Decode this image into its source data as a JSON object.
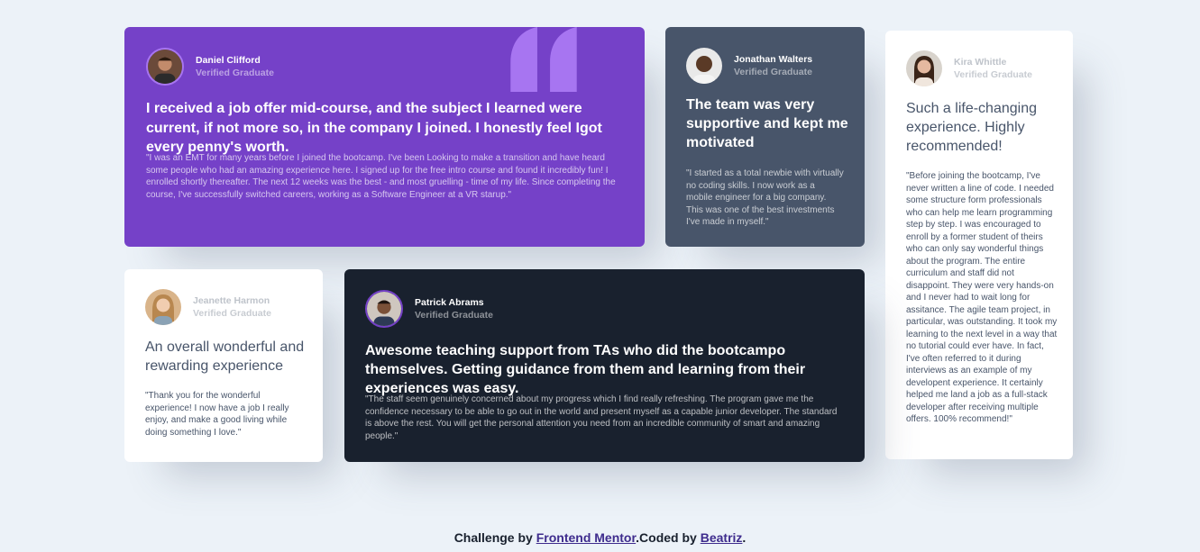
{
  "testimonials": {
    "daniel": {
      "name": "Daniel Clifford",
      "role": "Verified Graduate",
      "headline": "I received a job offer mid-course, and the subject I learned were current, if not more so, in the company I joined. I honestly feel Igot every penny's worth.",
      "quote": "\"I was an EMT for many years before I joined the bootcamp. I've been Looking to make a transition and have heard some people who had an amazing experience here. I signed up for the free intro course and found it incredibly fun! I enrolled shortly thereafter. The next 12 weeks was the best - and most gruelling - time of my life. Since completing the course, I've successfully switched careers, working as a Software Engineer at a VR starup.\""
    },
    "jonathan": {
      "name": "Jonathan Walters",
      "role": "Verified Graduate",
      "headline": "The team was very supportive and kept me motivated",
      "quote": "\"I started as a total newbie with virtually no coding skills. I now work as a mobile engineer for a big company. This was one of the best investments I've made in myself.\""
    },
    "kira": {
      "name": "Kira Whittle",
      "role": "Verified Graduate",
      "headline": "Such a life-changing experience. Highly recommended!",
      "quote": "\"Before joining the bootcamp, I've never written a line of code. I needed some structure form professionals who can help me learn programming step by step. I was encouraged to enroll by a former student of theirs who can only say wonderful things about the program. The entire curriculum and staff did not disappoint. They were very hands-on and I never had to wait long for assitance. The agile team project, in particular, was outstanding. It took my learning to the next level in a way that no tutorial could ever have. In fact, I've often referred to it during interviews as an example of my developent experience. It certainly helped me land a job as a full-stack developer after receiving multiple offers. 100% recommend!\""
    },
    "jeanette": {
      "name": "Jeanette Harmon",
      "role": "Verified Graduate",
      "headline": "An overall wonderful and rewarding experience",
      "quote": "\"Thank you for the wonderful experience! I now have a job I really enjoy, and make a good living while doing something I love.\""
    },
    "patrick": {
      "name": "Patrick Abrams",
      "role": "Verified Graduate",
      "headline": "Awesome teaching support from TAs who did the bootcampo themselves. Getting guidance from them and learning from their experiences was easy.",
      "quote": "\"The staff seem genuinely concerned about my progress which I find really refreshing. The program gave me the confidence necessary to be able to go out in the world and present myself as a capable junior developer. The standard is above the rest. You will get the personal attention you need from an incredible community of smart and amazing people.\""
    }
  },
  "footer": {
    "prefix": "Challenge by ",
    "link1": "Frontend Mentor",
    "middle": ".Coded by ",
    "link2": "Beatriz",
    "suffix": "."
  },
  "colors": {
    "background": "#ecf2f8",
    "purple": "#7541c8",
    "grayish_blue": "#48556a",
    "dark_blackish_blue": "#19212e",
    "white": "#ffffff"
  },
  "icons": {
    "quote": "quotation-mark-icon",
    "avatar": "user-avatar"
  }
}
